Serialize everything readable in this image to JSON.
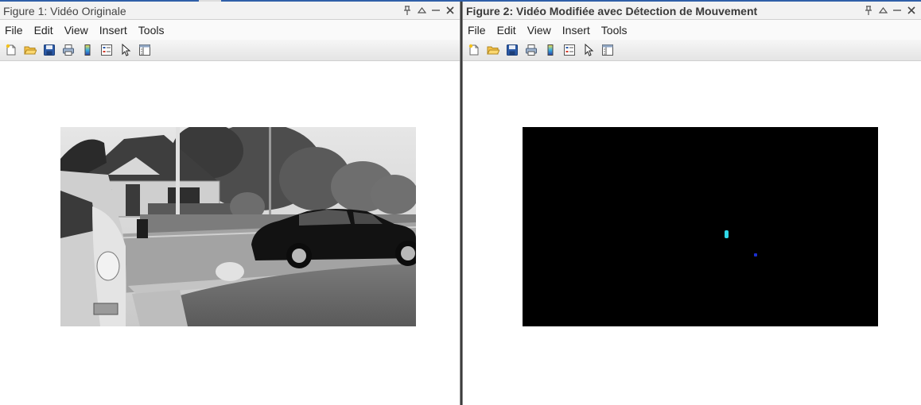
{
  "figures": [
    {
      "title": "Figure 1: Vidéo Originale",
      "menu": [
        "File",
        "Edit",
        "View",
        "Insert",
        "Tools"
      ],
      "controls": [
        "pin-icon",
        "undock-icon",
        "minimize-icon",
        "close-icon"
      ],
      "toolbar": [
        "new-figure-icon",
        "open-file-icon",
        "save-icon",
        "print-icon",
        "colorbar-icon",
        "legend-icon",
        "pointer-icon",
        "property-inspector-icon"
      ],
      "content": "grayscale video frame"
    },
    {
      "title": "Figure 2: Vidéo Modifiée avec Détection de Mouvement",
      "menu": [
        "File",
        "Edit",
        "View",
        "Insert",
        "Tools"
      ],
      "controls": [
        "pin-icon",
        "undock-icon",
        "minimize-icon",
        "close-icon"
      ],
      "toolbar": [
        "new-figure-icon",
        "open-file-icon",
        "save-icon",
        "print-icon",
        "colorbar-icon",
        "legend-icon",
        "pointer-icon",
        "property-inspector-icon"
      ],
      "content": "motion detection mask",
      "detections": [
        {
          "color": "#2fd8e8"
        },
        {
          "color": "#1a2fcf"
        }
      ]
    }
  ],
  "colors": {
    "titlebar_bg": "#f2f2f2",
    "mask_bg": "#000000",
    "accent": "#2f5fa8"
  }
}
